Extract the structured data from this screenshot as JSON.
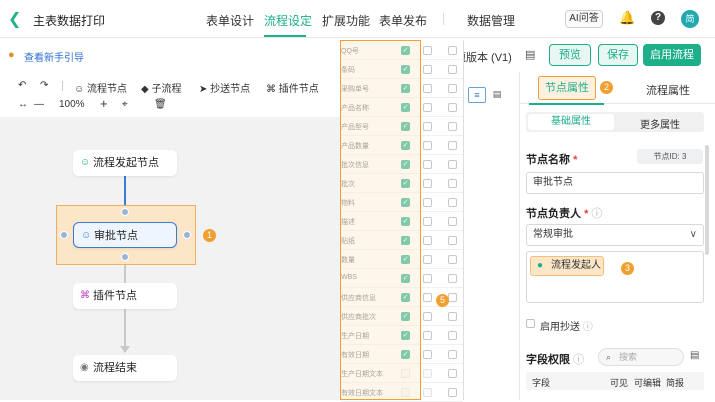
{
  "topbar": {
    "app_title": "主表数据打印",
    "tabs": [
      "表单设计",
      "流程设定",
      "扩展功能",
      "表单发布",
      "数据管理"
    ],
    "active_tab": "流程设定",
    "ai_label": "AI问答",
    "avatar_initial": "简",
    "help_glyph": "?"
  },
  "subbar": {
    "guide_link": "查看新手引导",
    "version_label": "题版本 (V1)",
    "preview_label": "预览",
    "save_label": "保存",
    "enable_label": "启用流程"
  },
  "toolbar": {
    "items": [
      "流程节点",
      "子流程",
      "抄送节点",
      "插件节点"
    ],
    "zoom": "100%",
    "minus": "—",
    "plus": "+"
  },
  "flow": {
    "start_node": "流程发起节点",
    "approve_node": "审批节点",
    "plugin_node": "插件节点",
    "end_node": "流程结束",
    "badge_1": "1"
  },
  "fields": [
    {
      "name": "QQ号",
      "visible": true,
      "editable": false
    },
    {
      "name": "条码",
      "visible": true,
      "editable": false
    },
    {
      "name": "采购单号",
      "visible": true,
      "editable": false
    },
    {
      "name": "产品名称",
      "visible": true,
      "editable": false
    },
    {
      "name": "产品型号",
      "visible": true,
      "editable": false
    },
    {
      "name": "产品数量",
      "visible": true,
      "editable": false
    },
    {
      "name": "批次信息",
      "visible": true,
      "editable": false
    },
    {
      "name": "批次",
      "visible": true,
      "editable": false
    },
    {
      "name": "物料",
      "visible": true,
      "editable": false
    },
    {
      "name": "描述",
      "visible": true,
      "editable": false
    },
    {
      "name": "贴纸",
      "visible": true,
      "editable": false
    },
    {
      "name": "数量",
      "visible": true,
      "editable": false
    },
    {
      "name": "WBS",
      "visible": true,
      "editable": false
    },
    {
      "name": "供应商信息",
      "visible": true,
      "editable": false
    },
    {
      "name": "供应商批次",
      "visible": true,
      "editable": false
    },
    {
      "name": "生产日期",
      "visible": true,
      "editable": false
    },
    {
      "name": "有效日期",
      "visible": true,
      "editable": false
    },
    {
      "name": "生产日期文本",
      "visible": false,
      "editable": false
    },
    {
      "name": "有效日期文本",
      "visible": false,
      "editable": false
    }
  ],
  "fields_badge": "5",
  "panel": {
    "tab_node": "节点属性",
    "tab_flow": "流程属性",
    "tab_badge": "2",
    "sub_basic": "基础属性",
    "sub_more": "更多属性",
    "node_name_label": "节点名称",
    "node_id": "节点ID: 3",
    "node_name_value": "审批节点",
    "owner_label": "节点负责人",
    "owner_mode": "常规审批",
    "initiator_tag": "流程发起人",
    "initiator_badge": "3",
    "cc_label": "启用抄送",
    "perm_label": "字段权限",
    "search_placeholder": "搜索",
    "col_field": "字段",
    "col_visible": "可见",
    "col_editable": "可编辑",
    "col_summary": "简报"
  },
  "colors": {
    "accent": "#1dae8a",
    "highlight": "#f0a030",
    "link": "#2f6fd1"
  }
}
